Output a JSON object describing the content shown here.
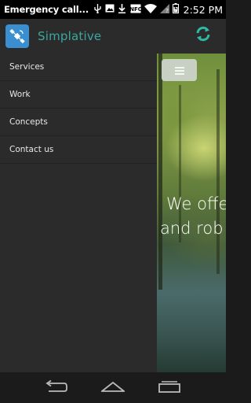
{
  "status_bar": {
    "carrier": "Emergency call...",
    "time": "2:52 PM",
    "battery": "charging",
    "icons": [
      "usb-icon",
      "image-icon",
      "download-icon",
      "nfc-icon",
      "wifi-icon",
      "signal-icon",
      "battery-icon"
    ]
  },
  "app_bar": {
    "title": "Simplative",
    "logo_icon": "satellite-icon",
    "action_icon": "refresh-icon",
    "accent_color": "#3aa8a0"
  },
  "drawer": {
    "items": [
      {
        "label": "Services"
      },
      {
        "label": "Work"
      },
      {
        "label": "Concepts"
      },
      {
        "label": "Contact us"
      }
    ]
  },
  "content": {
    "menu_icon": "hamburger-icon",
    "hero_line1": "We offe",
    "hero_line2": "and rob"
  },
  "nav_bar": {
    "icons": [
      "back-icon",
      "home-icon",
      "recents-icon"
    ]
  }
}
